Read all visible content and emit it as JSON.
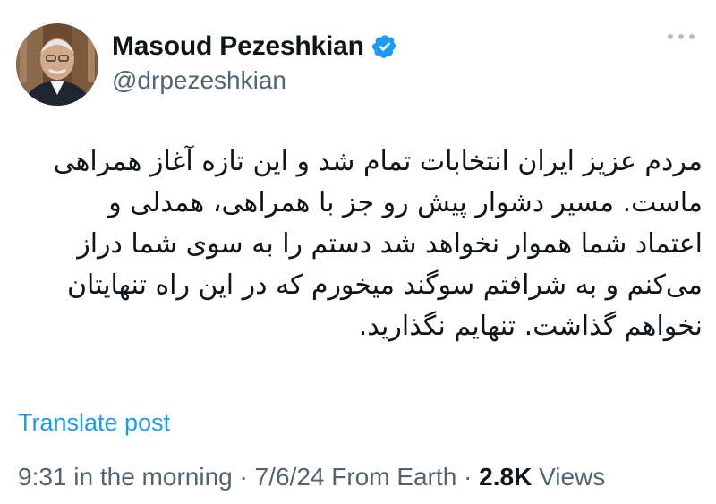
{
  "author": {
    "display_name": "Masoud Pezeshkian",
    "handle": "@drpezeshkian",
    "verified_icon": "verified-badge-icon",
    "avatar_icon": "profile-photo"
  },
  "post": {
    "direction": "rtl",
    "lines": [
      "مردم عزیز ایران انتخابات تمام شد و این تازه آغاز همراهی",
      "ماست. مسیر دشوار پیش رو جز با همراهی، همدلی و",
      "اعتماد شما هموار نخواهد شد دستم را به سوی شما دراز",
      "می‌کنم و به شرافتم سوگند میخورم که در این راه تنهایتان",
      "نخواهم گذاشت. تنهایم نگذارید."
    ],
    "translate_label": "Translate post"
  },
  "meta": {
    "time": "9:31 in the morning",
    "sep1": " · ",
    "date": "7/6/24",
    "source": " From Earth",
    "sep2": " · ",
    "views_count": "2.8K",
    "views_label": " Views"
  },
  "colors": {
    "link": "#1d9bf0",
    "secondary_text": "#536471",
    "primary_text": "#0f1419",
    "verified": "#1d9bf0"
  }
}
